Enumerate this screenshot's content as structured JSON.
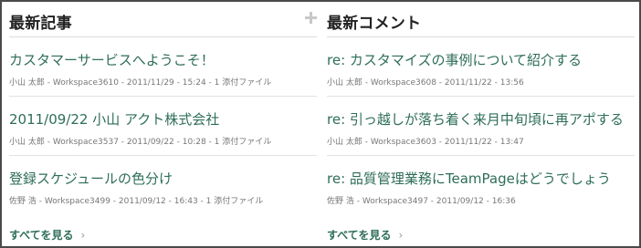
{
  "latest_articles": {
    "title": "最新記事",
    "add_icon": "plus-icon",
    "items": [
      {
        "title": "カスタマーサービスへようこそ！",
        "meta": "小山 太郎 - Workspace3610 - 2011/11/29 - 15:24 - 1 添付ファイル"
      },
      {
        "title": "2011/09/22 小山 アクト株式会社",
        "meta": "小山 太郎 - Workspace3537 - 2011/09/22 - 10:28 - 1 添付ファイル"
      },
      {
        "title": "登録スケジュールの色分け",
        "meta": "佐野 浩 - Workspace3499 - 2011/09/12 - 16:43 - 1 添付ファイル"
      }
    ],
    "see_all": "すべてを見る",
    "see_all_icon": "chevron-right-icon"
  },
  "latest_comments": {
    "title": "最新コメント",
    "items": [
      {
        "title": "re: カスタマイズの事例について紹介する",
        "meta": "小山 太郎 - Workspace3608 - 2011/11/22 - 13:56"
      },
      {
        "title": "re: 引っ越しが落ち着く来月中旬頃に再アポする",
        "meta": "小山 太郎 - Workspace3603 - 2011/11/22 - 13:47"
      },
      {
        "title": "re: 品質管理業務にTeamPageはどうでしょう",
        "meta": "佐野 浩 - Workspace3497 - 2011/09/12 - 16:36"
      }
    ],
    "see_all": "すべてを見る",
    "see_all_icon": "chevron-right-icon"
  },
  "colors": {
    "link": "#2e6e57",
    "meta": "#777777",
    "heading": "#222222",
    "border": "#4a4a4a"
  }
}
